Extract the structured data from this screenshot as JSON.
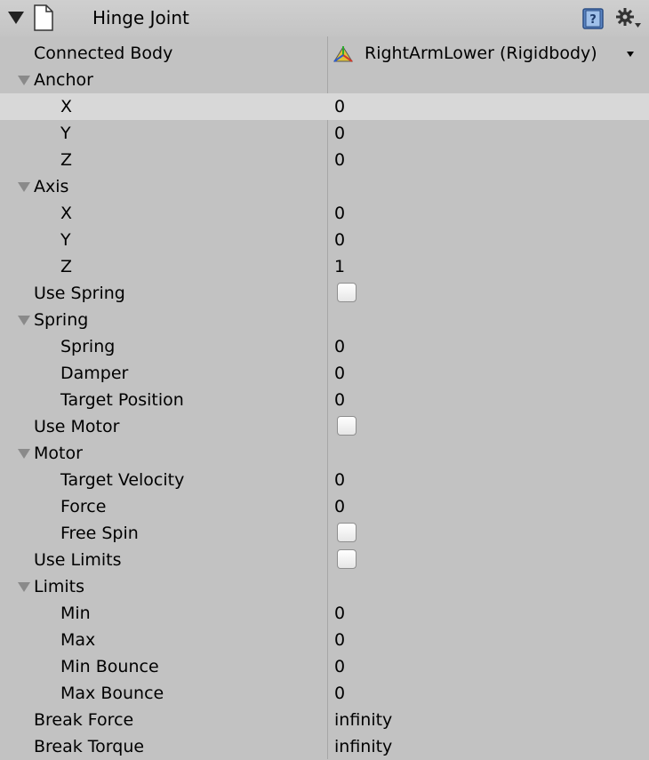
{
  "header": {
    "title": "Hinge Joint",
    "icons": [
      "foldout-triangle-icon",
      "document-icon",
      "help-book-icon",
      "gear-icon"
    ]
  },
  "connected_body": {
    "label": "Connected Body",
    "value": "RightArmLower (Rigidbody)",
    "icon": "rigidbody-axes-icon"
  },
  "anchor": {
    "label": "Anchor",
    "x": {
      "label": "X",
      "value": "0"
    },
    "y": {
      "label": "Y",
      "value": "0"
    },
    "z": {
      "label": "Z",
      "value": "0"
    }
  },
  "axis": {
    "label": "Axis",
    "x": {
      "label": "X",
      "value": "0"
    },
    "y": {
      "label": "Y",
      "value": "0"
    },
    "z": {
      "label": "Z",
      "value": "1"
    }
  },
  "use_spring": {
    "label": "Use Spring",
    "checked": false
  },
  "spring": {
    "label": "Spring",
    "spring": {
      "label": "Spring",
      "value": "0"
    },
    "damper": {
      "label": "Damper",
      "value": "0"
    },
    "target_position": {
      "label": "Target Position",
      "value": "0"
    }
  },
  "use_motor": {
    "label": "Use Motor",
    "checked": false
  },
  "motor": {
    "label": "Motor",
    "target_velocity": {
      "label": "Target Velocity",
      "value": "0"
    },
    "force": {
      "label": "Force",
      "value": "0"
    },
    "free_spin": {
      "label": "Free Spin",
      "checked": false
    }
  },
  "use_limits": {
    "label": "Use Limits",
    "checked": false
  },
  "limits": {
    "label": "Limits",
    "min": {
      "label": "Min",
      "value": "0"
    },
    "max": {
      "label": "Max",
      "value": "0"
    },
    "min_bounce": {
      "label": "Min Bounce",
      "value": "0"
    },
    "max_bounce": {
      "label": "Max Bounce",
      "value": "0"
    }
  },
  "break_force": {
    "label": "Break Force",
    "value": "infinity"
  },
  "break_torque": {
    "label": "Break Torque",
    "value": "infinity"
  }
}
